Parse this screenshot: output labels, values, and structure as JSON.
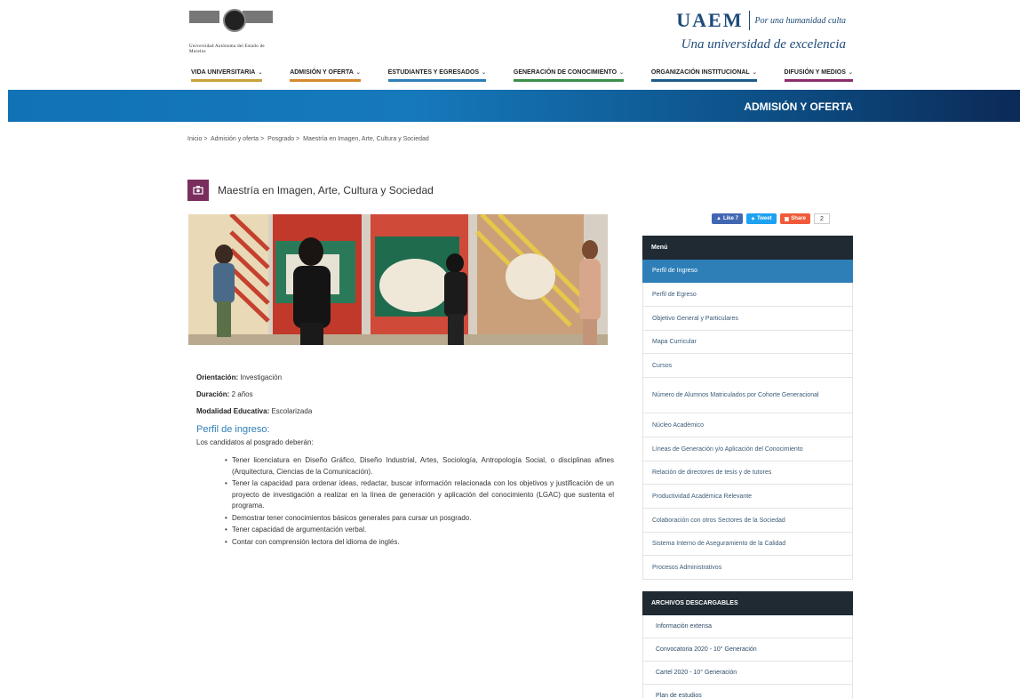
{
  "header": {
    "logo_text": "Universidad Autónoma del Estado de Morelos",
    "uaem_name": "UAEM",
    "uaem_motto": "Por una humanidad culta",
    "uaem_tagline": "Una universidad de excelencia"
  },
  "nav": {
    "items": [
      {
        "label": "VIDA UNIVERSITARIA"
      },
      {
        "label": "ADMISIÓN Y OFERTA"
      },
      {
        "label": "ESTUDIANTES Y EGRESADOS"
      },
      {
        "label": "GENERACIÓN DE CONOCIMIENTO"
      },
      {
        "label": "ORGANIZACIÓN INSTITUCIONAL"
      },
      {
        "label": "DIFUSIÓN Y MEDIOS"
      }
    ]
  },
  "banner": {
    "title": "ADMISIÓN Y OFERTA"
  },
  "breadcrumb": [
    "Inicio",
    "Admisión y oferta",
    "Posgrado",
    "Maestría en Imagen, Arte, Cultura y Sociedad"
  ],
  "page": {
    "title": "Maestría en Imagen, Arte, Cultura y Sociedad"
  },
  "share": {
    "like": "Like 7",
    "tweet": "Tweet",
    "share": "Share",
    "count": "2"
  },
  "info": {
    "orientacion_label": "Orientación:",
    "orientacion_value": "Investigación",
    "duracion_label": "Duración:",
    "duracion_value": "2 años",
    "modalidad_label": "Modalidad Educativa:",
    "modalidad_value": "Escolarizada",
    "section_title": "Perfil de ingreso:",
    "lead": "Los candidatos al posgrado deberán:",
    "bullets": [
      "Tener licenciatura en Diseño Gráfico, Diseño Industrial, Artes, Sociología, Antropología Social, o disciplinas afines (Arquitectura, Ciencias de la Comunicación).",
      "Tener la capacidad para ordenar ideas, redactar, buscar información relacionada con los objetivos y justificación de un proyecto de investigación a realizar en la línea de generación y aplicación del conocimiento (LGAC) que sustenta el programa.",
      "Demostrar tener conocimientos básicos generales para cursar un posgrado.",
      "Tener capacidad de argumentación verbal.",
      "Contar con comprensión lectora del idioma de inglés."
    ]
  },
  "menu": {
    "title": "Menú",
    "items": [
      {
        "label": "Perfil de Ingreso",
        "active": true
      },
      {
        "label": "Perfil de Egreso"
      },
      {
        "label": "Objetivo General y Particulares"
      },
      {
        "label": "Mapa Curricular"
      },
      {
        "label": "Cursos"
      },
      {
        "label": "Número de Alumnos Matriculados por Cohorte Generacional"
      },
      {
        "label": "Núcleo Académico"
      },
      {
        "label": "Líneas de Generación y/o Aplicación del Conocimiento"
      },
      {
        "label": "Relación de directores de tesis y de tutores"
      },
      {
        "label": "Productividad Académica Relevante"
      },
      {
        "label": "Colaboración con otros Sectores de la Sociedad"
      },
      {
        "label": "Sistema Interno de Aseguramiento de la Calidad"
      },
      {
        "label": "Procesos Administrativos"
      }
    ]
  },
  "files": {
    "title": "ARCHIVOS DESCARGABLES",
    "items": [
      {
        "label": "Información extensa"
      },
      {
        "label": "Convocatoria 2020 - 10° Generación"
      },
      {
        "label": "Cartel 2020 - 10° Generación"
      },
      {
        "label": "Plan de estudios"
      }
    ]
  },
  "colors": {
    "accent_blue": "#2e7fb8",
    "title_icon": "#7a2e5e",
    "sidebar_header": "#1f2a33"
  }
}
